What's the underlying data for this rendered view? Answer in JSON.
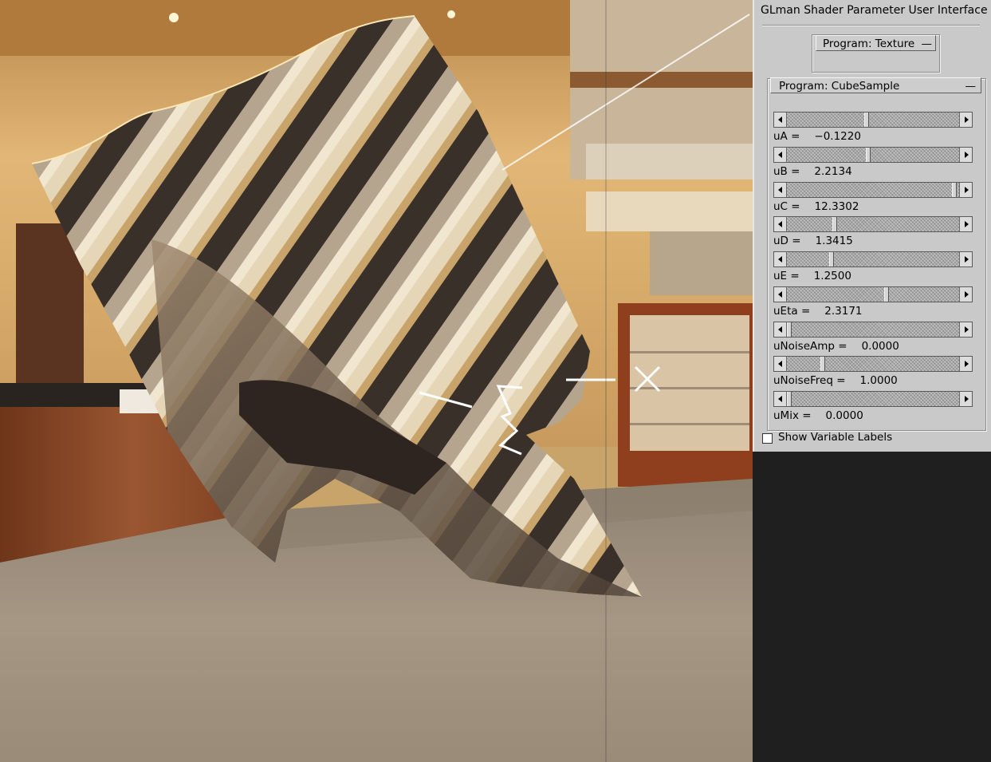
{
  "panel": {
    "title": "GLman Shader Parameter User Interface",
    "rollout_texture_label": "Program: Texture",
    "rollout_texture_toggle": "—",
    "rollout_cubesample_label": "Program: CubeSample",
    "rollout_cubesample_toggle": "—",
    "show_variable_labels": "Show Variable Labels",
    "show_variable_labels_checked": false
  },
  "sliders": [
    {
      "name": "uA =",
      "value": "−0.1220",
      "level": 0.46
    },
    {
      "name": "uB =",
      "value": "2.2134",
      "level": 0.47
    },
    {
      "name": "uC =",
      "value": "12.3302",
      "level": 0.985
    },
    {
      "name": "uD =",
      "value": "1.3415",
      "level": 0.27
    },
    {
      "name": "uE =",
      "value": "1.2500",
      "level": 0.25
    },
    {
      "name": "uEta =",
      "value": "2.3171",
      "level": 0.58
    },
    {
      "name": "uNoiseAmp =",
      "value": "0.0000",
      "level": 0.0
    },
    {
      "name": "uNoiseFreq =",
      "value": "1.0000",
      "level": 0.2
    },
    {
      "name": "uMix =",
      "value": "0.0000",
      "level": 0.0
    }
  ],
  "colors": {
    "panel_bg": "#c9c9c9",
    "viewport_wall": "#d9ad6c",
    "viewport_floor": "#9c8c78",
    "counter": "#8a4a2a"
  }
}
